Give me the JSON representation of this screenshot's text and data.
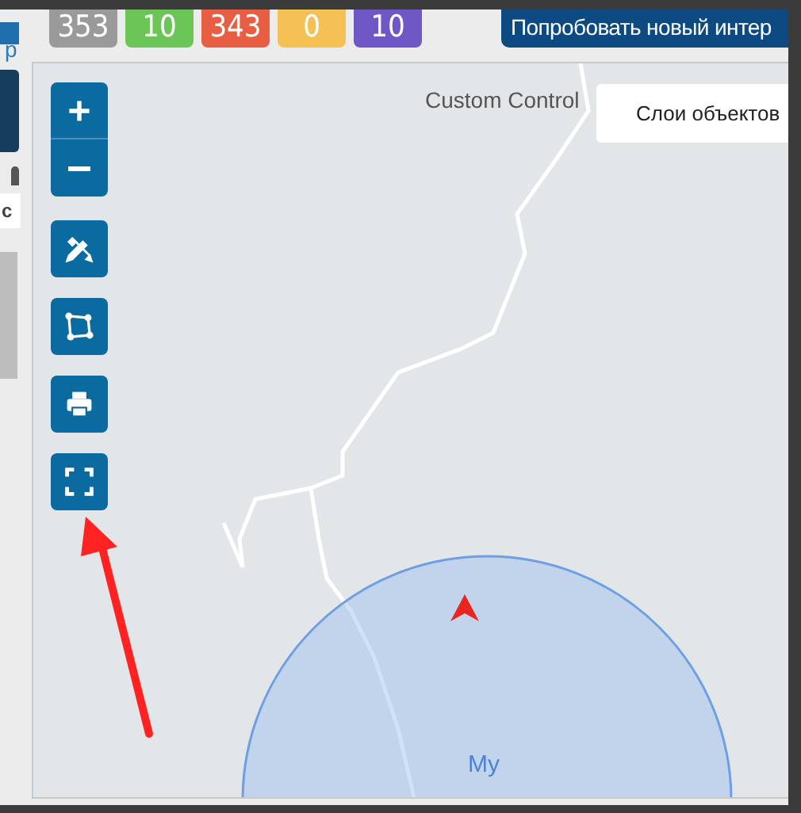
{
  "counters": [
    {
      "text": "353",
      "color": "#9a9a9a"
    },
    {
      "text": "10",
      "color": "#6cc657"
    },
    {
      "text": "343",
      "color": "#e85e42"
    },
    {
      "text": "0",
      "color": "#f5c154"
    },
    {
      "text": "10",
      "color": "#6f57c6"
    }
  ],
  "try_button": {
    "label": "Попробовать новый интер"
  },
  "sidebar": {
    "link_fragment": "р",
    "tab_fragment": "с"
  },
  "map": {
    "controls": [
      {
        "kind": "zoom"
      },
      {
        "kind": "draw"
      },
      {
        "kind": "polygon"
      },
      {
        "kind": "print"
      },
      {
        "kind": "fullscreen"
      }
    ],
    "custom_control": "Custom Control",
    "layers_button": "Слои объектов",
    "circle_label": "My"
  }
}
